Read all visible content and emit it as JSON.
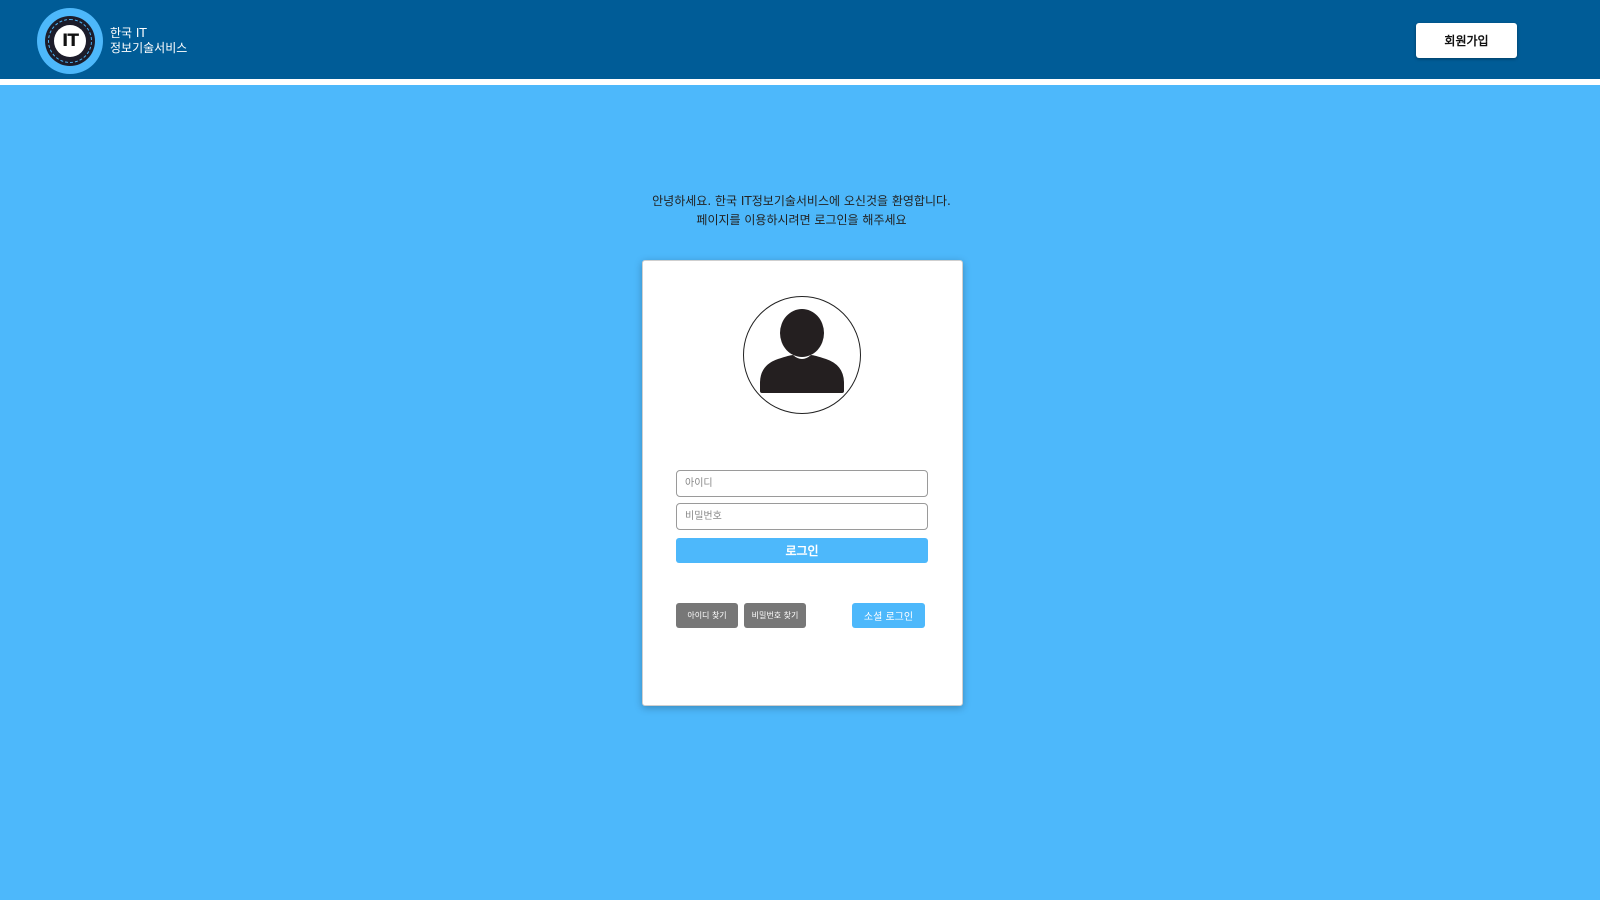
{
  "header": {
    "brand_line1": "한국 IT",
    "brand_line2": "정보기술서비스",
    "logo_text": "IT",
    "signup_label": "회원가입"
  },
  "welcome": {
    "line1": "안녕하세요. 한국 IT정보기술서비스에 오신것을 환영합니다.",
    "line2": "페이지를 이용하시려면 로그인을 해주세요"
  },
  "login_form": {
    "avatar_icon": "user-silhouette-icon",
    "id_placeholder": "아이디",
    "password_placeholder": "비밀번호",
    "login_label": "로그인",
    "find_id_label": "아이디 찾기",
    "find_password_label": "비밀번호 찾기",
    "social_login_label": "소셜 로그인"
  },
  "colors": {
    "header_bg": "#005c97",
    "page_bg": "#4db8fb",
    "accent": "#4db8fb",
    "secondary_button": "#777777"
  }
}
